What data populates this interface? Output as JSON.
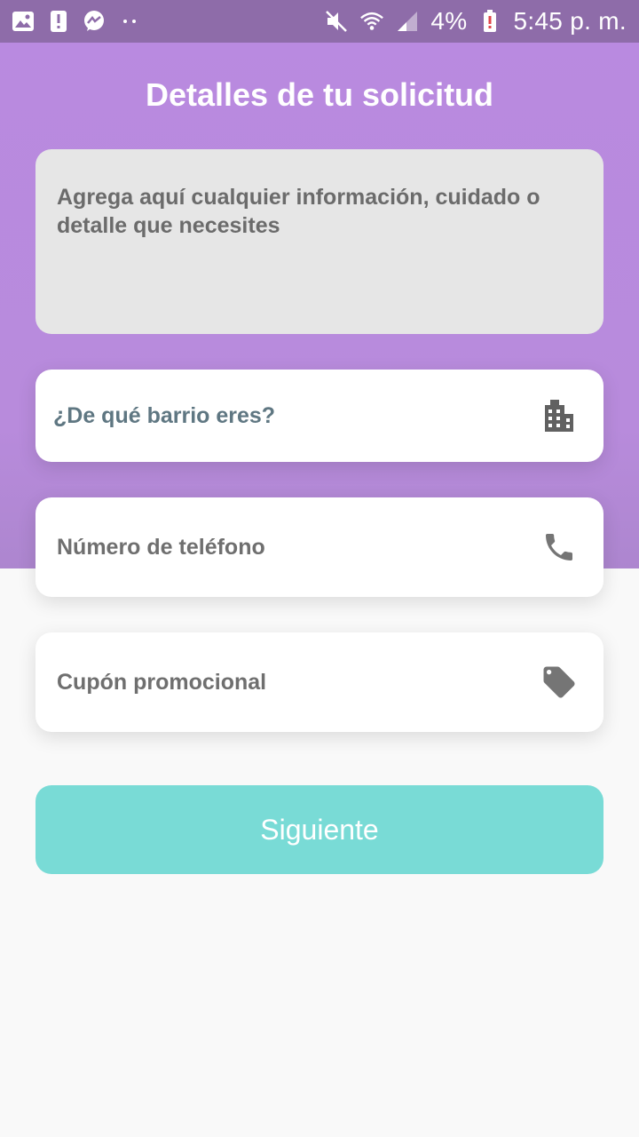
{
  "status_bar": {
    "left_icons": [
      "image-icon",
      "alert-icon",
      "messenger-icon",
      "more-dots-icon"
    ],
    "right_icons": [
      "mute-icon",
      "wifi-icon",
      "signal-icon",
      "battery-alert-icon"
    ],
    "battery": "4%",
    "time": "5:45 p. m."
  },
  "header": {
    "title": "Detalles de tu solicitud"
  },
  "form": {
    "details_placeholder": "Agrega aquí cualquier información, cuidado o detalle que necesites",
    "neighborhood_label": "¿De qué barrio eres?",
    "neighborhood_icon": "building-icon",
    "phone_placeholder": "Número de teléfono",
    "phone_icon": "phone-icon",
    "coupon_placeholder": "Cupón promocional",
    "coupon_icon": "tag-icon"
  },
  "actions": {
    "next_label": "Siguiente"
  },
  "colors": {
    "header_bg": "#b98ae0",
    "status_bar_bg": "#8e6ca9",
    "button_bg": "#79dbd6",
    "textarea_bg": "#e6e6e6"
  }
}
